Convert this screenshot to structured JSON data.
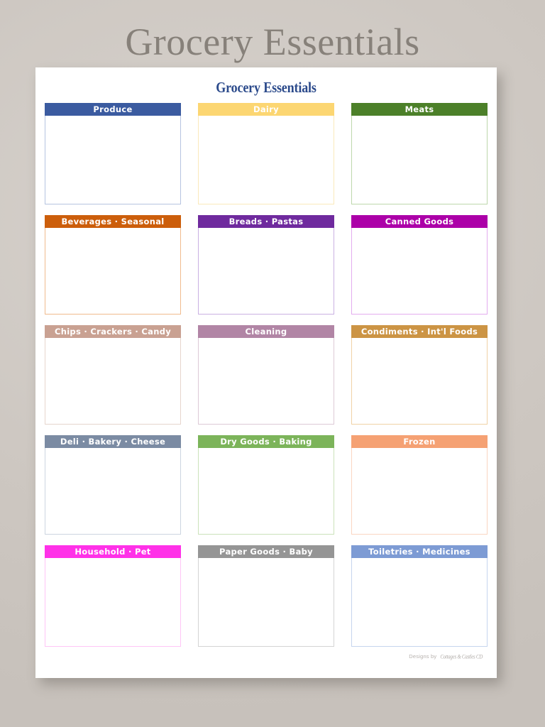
{
  "outer_title": "Grocery Essentials",
  "sheet": {
    "title": "Grocery Essentials",
    "footer": {
      "prefix": "Designs by",
      "signature": "Cottages & Castles CD"
    }
  },
  "categories": [
    {
      "label": "Produce",
      "header_color": "#3b5ba0",
      "body_border": "#b6c4e0"
    },
    {
      "label": "Dairy",
      "header_color": "#fcd672",
      "body_border": "#fae9bb"
    },
    {
      "label": "Meats",
      "header_color": "#4c8029",
      "body_border": "#bdd7ac"
    },
    {
      "label": "Beverages · Seasonal",
      "header_color": "#cc5e0b",
      "body_border": "#f0bb8e"
    },
    {
      "label": "Breads ·  Pastas",
      "header_color": "#6f2a9e",
      "body_border": "#c9b0e2"
    },
    {
      "label": "Canned Goods",
      "header_color": "#ac00a8",
      "body_border": "#e3acef"
    },
    {
      "label": "Chips ·  Crackers · Candy",
      "header_color": "#c9a192",
      "body_border": "#e6d5cd"
    },
    {
      "label": "Cleaning",
      "header_color": "#b185a5",
      "body_border": "#ddcad6"
    },
    {
      "label": "Condiments ·  Int'l Foods",
      "header_color": "#cc9444",
      "body_border": "#f0d2a6"
    },
    {
      "label": "Deli ·  Bakery · Cheese",
      "header_color": "#7b8ba3",
      "body_border": "#ccd5e0"
    },
    {
      "label": "Dry Goods ·  Baking",
      "header_color": "#7cb45a",
      "body_border": "#cbe2ba"
    },
    {
      "label": "Frozen",
      "header_color": "#f5a173",
      "body_border": "#fad6c2"
    },
    {
      "label": "Household ·  Pet",
      "header_color": "#ff31e8",
      "body_border": "#ffc5f6"
    },
    {
      "label": "Paper Goods ·  Baby",
      "header_color": "#959595",
      "body_border": "#d4d4d4"
    },
    {
      "label": "Toiletries ·  Medicines",
      "header_color": "#7d9bd4",
      "body_border": "#c6d5ee"
    }
  ]
}
